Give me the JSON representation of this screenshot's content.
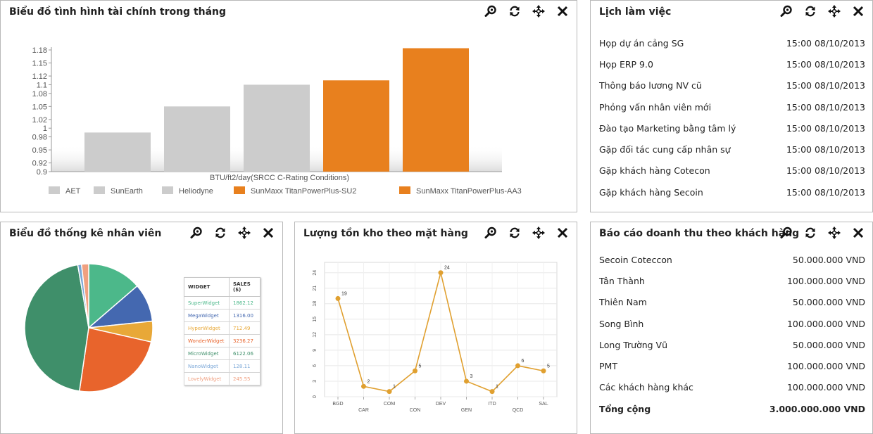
{
  "panels": {
    "finance": {
      "title": "Biểu đồ tình hình tài chính trong tháng"
    },
    "schedule": {
      "title": "Lịch làm việc"
    },
    "staff": {
      "title": "Biểu đồ thống kê nhân viên"
    },
    "inventory": {
      "title": "Lượng tồn kho theo mặt hàng"
    },
    "revenue": {
      "title": "Báo cáo doanh thu theo khách hàng"
    }
  },
  "tool_icons": [
    "zoom-icon",
    "refresh-icon",
    "move-icon",
    "close-icon"
  ],
  "schedule": {
    "items": [
      {
        "label": "Họp dự án cảng SG",
        "time": "15:00 08/10/2013"
      },
      {
        "label": "Họp ERP 9.0",
        "time": "15:00 08/10/2013"
      },
      {
        "label": "Thông báo lương NV cũ",
        "time": "15:00 08/10/2013"
      },
      {
        "label": "Phỏng vấn nhân viên mới",
        "time": "15:00 08/10/2013"
      },
      {
        "label": "Đào tạo Marketing bằng tâm lý",
        "time": "15:00 08/10/2013"
      },
      {
        "label": "Gặp đối tác cung cấp nhân sự",
        "time": "15:00 08/10/2013"
      },
      {
        "label": "Gặp khách hàng Cotecon",
        "time": "15:00 08/10/2013"
      },
      {
        "label": "Gặp khách hàng Secoin",
        "time": "15:00 08/10/2013"
      }
    ]
  },
  "revenue": {
    "items": [
      {
        "label": "Secoin Coteccon",
        "amount": "50.000.000 VND"
      },
      {
        "label": "Tân Thành",
        "amount": "100.000.000 VND"
      },
      {
        "label": "Thiên Nam",
        "amount": "50.000.000 VND"
      },
      {
        "label": "Song Bình",
        "amount": "100.000.000 VND"
      },
      {
        "label": "Long Trường Vũ",
        "amount": "50.000.000 VND"
      },
      {
        "label": "PMT",
        "amount": "100.000.000 VND"
      },
      {
        "label": "Các khách hàng khác",
        "amount": "100.000.000 VND"
      }
    ],
    "total": {
      "label": "Tổng cộng",
      "amount": "3.000.000.000 VND"
    }
  },
  "chart_data": [
    {
      "type": "bar",
      "categories": [
        "AET",
        "SunEarth",
        "Heliodyne",
        "SunMaxx TitanPowerPlus-SU2",
        "SunMaxx TitanPowerPlus-AA3"
      ],
      "values": [
        0.99,
        1.05,
        1.1,
        1.11,
        1.184
      ],
      "colors": [
        "#cccccc",
        "#cccccc",
        "#cccccc",
        "#e8801e",
        "#e8801e"
      ],
      "xlabel": "BTU/ft2/day(SRCC C-Rating Conditions)",
      "ylim": [
        0.9,
        1.18
      ],
      "yticks": [
        "0.9",
        "0.92",
        "0.95",
        "0.98",
        "1",
        "1.02",
        "1.05",
        "1.08",
        "1.1",
        "1.12",
        "1.15",
        "1.18"
      ],
      "yticks_values": [
        0.9,
        0.92,
        0.95,
        0.98,
        1,
        1.02,
        1.05,
        1.08,
        1.1,
        1.12,
        1.15,
        1.18
      ],
      "legend": "bottom"
    },
    {
      "type": "pie",
      "table_headers": [
        "WIDGET",
        "SALES ($)"
      ],
      "slices": [
        {
          "name": "SuperWidget",
          "value": 1862.12,
          "label": "1862.12",
          "color": "#4cb88a"
        },
        {
          "name": "MegaWidget",
          "value": 1316.0,
          "label": "1316.00",
          "color": "#4468b0"
        },
        {
          "name": "HyperWidget",
          "value": 712.49,
          "label": "712.49",
          "color": "#e8a838"
        },
        {
          "name": "WonderWidget",
          "value": 3236.27,
          "label": "3236.27",
          "color": "#e8642c"
        },
        {
          "name": "MicroWidget",
          "value": 6122.06,
          "label": "6122.06",
          "color": "#3f8f6a"
        },
        {
          "name": "NanoWidget",
          "value": 128.11,
          "label": "128.11",
          "color": "#7ca8d8"
        },
        {
          "name": "LovelyWidget",
          "value": 245.55,
          "label": "245.55",
          "color": "#f0a080"
        }
      ]
    },
    {
      "type": "line",
      "categories": [
        "BGD",
        "CAR",
        "COM",
        "CON",
        "DEV",
        "GEN",
        "ITD",
        "QCD",
        "SAL"
      ],
      "values": [
        19,
        2,
        1,
        5,
        24,
        3,
        1,
        6,
        5
      ],
      "ylim": [
        0,
        26
      ],
      "yticks": [
        0,
        3,
        6,
        9,
        12,
        15,
        18,
        21,
        24
      ],
      "color": "#e0a030"
    }
  ]
}
